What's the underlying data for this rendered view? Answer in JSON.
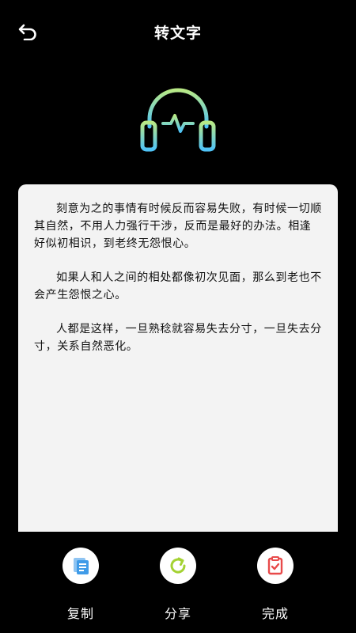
{
  "header": {
    "back_icon": "back-arrow-icon",
    "title": "转文字"
  },
  "hero": {
    "icon": "headphones-waveform-icon",
    "gradient": [
      "#b8e986",
      "#4fc3f7"
    ]
  },
  "content": {
    "paragraphs": [
      "刻意为之的事情有时候反而容易失败，有时候一切顺其自然，不用人力强行干涉，反而是最好的办法。相逢好似初相识，到老终无怨恨心。",
      "如果人和人之间的相处都像初次见面，那么到老也不会产生怨恨之心。",
      "人都是这样，一旦熟稔就容易失去分寸，一旦失去分寸，关系自然恶化。"
    ]
  },
  "actions": {
    "copy": {
      "label": "复制",
      "icon": "copy-icon",
      "color": "#3f9be8"
    },
    "share": {
      "label": "分享",
      "icon": "share-refresh-icon",
      "color": "#a4d233"
    },
    "done": {
      "label": "完成",
      "icon": "clipboard-check-icon",
      "color": "#e84a4a"
    }
  }
}
